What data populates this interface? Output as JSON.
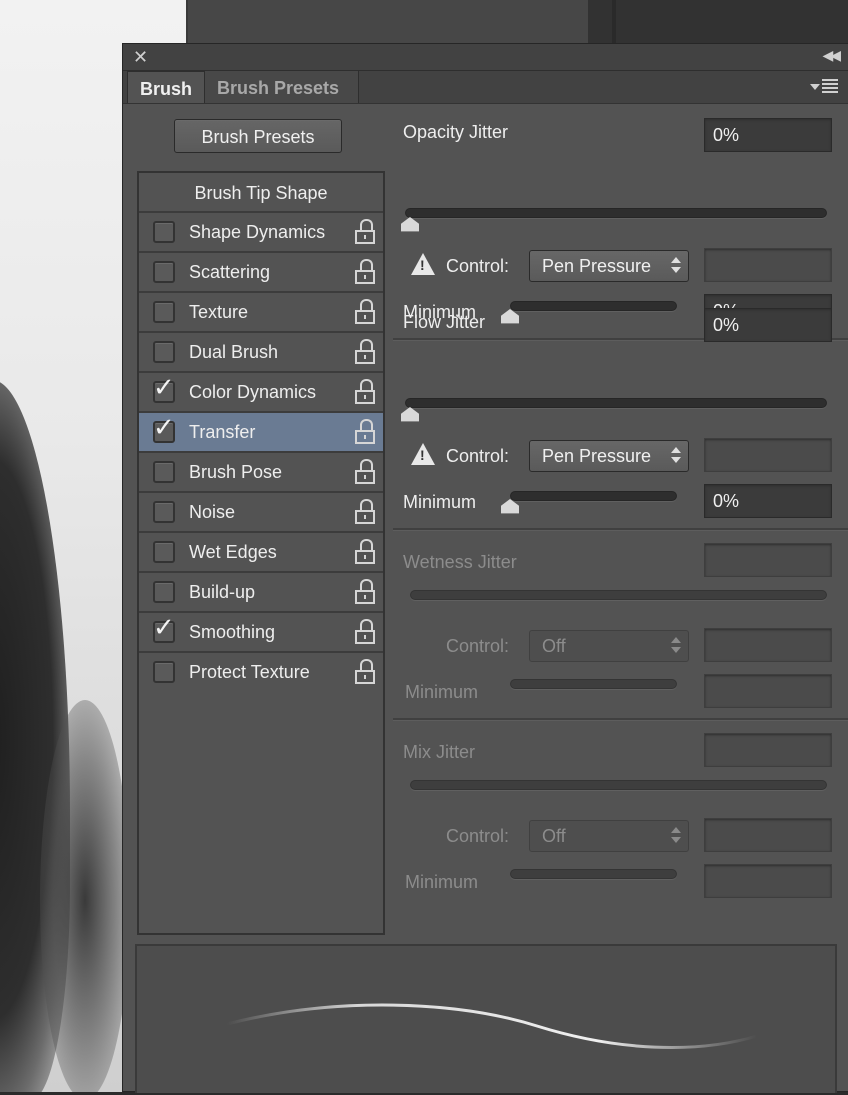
{
  "panel": {
    "tabs": [
      {
        "label": "Brush"
      },
      {
        "label": "Brush Presets"
      }
    ],
    "close_icon": "close-icon",
    "collapse_icon": "double-chevron-icon",
    "menu_icon": "panel-menu-icon"
  },
  "presets_button": "Brush Presets",
  "list": {
    "header": "Brush Tip Shape",
    "items": [
      {
        "label": "Shape Dynamics",
        "checked": false
      },
      {
        "label": "Scattering",
        "checked": false
      },
      {
        "label": "Texture",
        "checked": false
      },
      {
        "label": "Dual Brush",
        "checked": false
      },
      {
        "label": "Color Dynamics",
        "checked": true
      },
      {
        "label": "Transfer",
        "checked": true,
        "selected": true
      },
      {
        "label": "Brush Pose",
        "checked": false
      },
      {
        "label": "Noise",
        "checked": false
      },
      {
        "label": "Wet Edges",
        "checked": false
      },
      {
        "label": "Build-up",
        "checked": false
      },
      {
        "label": "Smoothing",
        "checked": true
      },
      {
        "label": "Protect Texture",
        "checked": false
      }
    ]
  },
  "opacity": {
    "title": "Opacity Jitter",
    "value": "0%",
    "slider_level": 0,
    "control_label": "Control:",
    "control_value": "Pen Pressure",
    "minimum_label": "Minimum",
    "minimum_value": "0%",
    "minimum_level": 0
  },
  "flow": {
    "title": "Flow Jitter",
    "value": "0%",
    "slider_level": 0,
    "control_label": "Control:",
    "control_value": "Pen Pressure",
    "minimum_label": "Minimum",
    "minimum_value": "0%",
    "minimum_level": 0
  },
  "wetness": {
    "title": "Wetness Jitter",
    "control_label": "Control:",
    "control_value": "Off",
    "minimum_label": "Minimum"
  },
  "mix": {
    "title": "Mix Jitter",
    "control_label": "Control:",
    "control_value": "Off",
    "minimum_label": "Minimum"
  },
  "colors": {
    "panel_bg": "#535353",
    "selected_row": "#6a7b93"
  }
}
